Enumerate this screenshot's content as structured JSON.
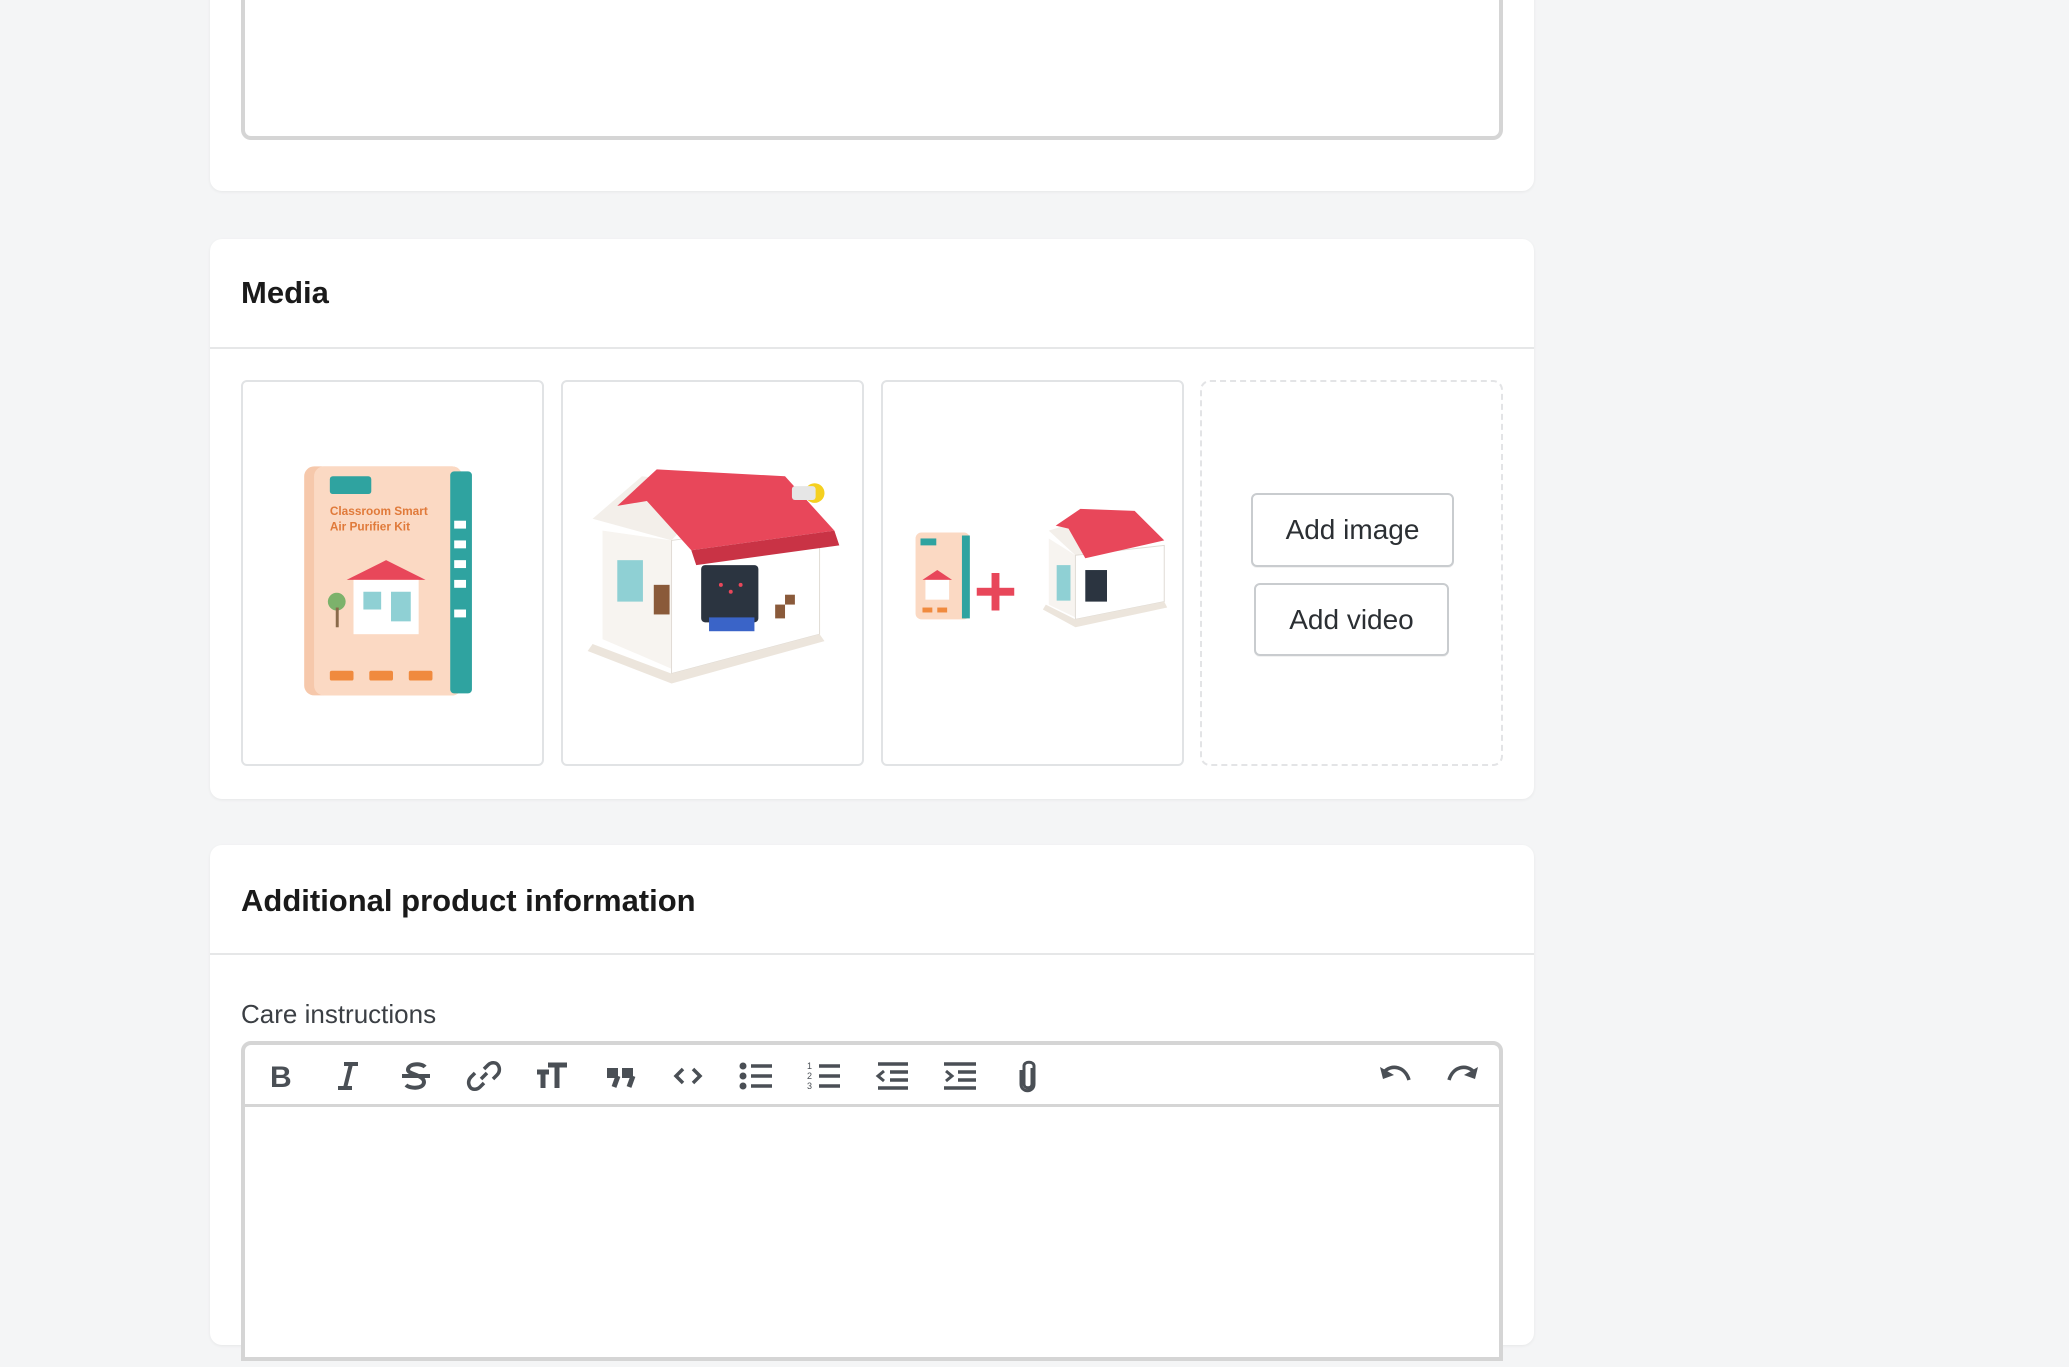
{
  "media": {
    "title": "Media",
    "images": [
      {
        "icon": "product-box-image",
        "box_title": "Classroom Smart Air Purifier Kit"
      },
      {
        "icon": "product-house-image"
      },
      {
        "icon": "product-kit-combo-image"
      }
    ],
    "add_image_label": "Add image",
    "add_video_label": "Add video"
  },
  "additional": {
    "title": "Additional product information",
    "care_label": "Care instructions",
    "toolbar": [
      "bold-icon",
      "italic-icon",
      "strikethrough-icon",
      "link-icon",
      "heading-icon",
      "quote-icon",
      "code-icon",
      "bullet-list-icon",
      "numbered-list-icon",
      "outdent-icon",
      "indent-icon",
      "attach-icon",
      "undo-icon",
      "redo-icon"
    ]
  },
  "colors": {
    "roof_red": "#e8475a",
    "accent_teal": "#2fa3a0",
    "page_bg": "#f4f5f6"
  }
}
